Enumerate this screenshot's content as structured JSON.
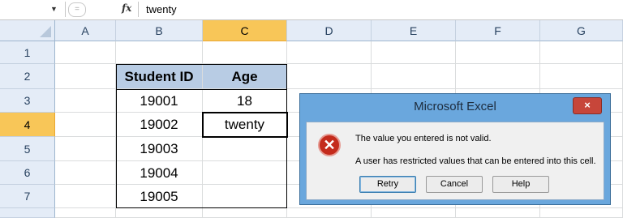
{
  "formula_bar": {
    "fx": "fx",
    "value": "twenty",
    "dd": "▼"
  },
  "columns": [
    "A",
    "B",
    "C",
    "D",
    "E",
    "F",
    "G"
  ],
  "rows": [
    "1",
    "2",
    "3",
    "4",
    "5",
    "6",
    "7"
  ],
  "table": {
    "headers": [
      "Student ID",
      "Age"
    ],
    "ids": [
      "19001",
      "19002",
      "19003",
      "19004",
      "19005"
    ],
    "ages": [
      "18",
      "twenty",
      "",
      "",
      ""
    ]
  },
  "dialog": {
    "title": "Microsoft Excel",
    "close": "×",
    "icon_glyph": "✕",
    "message1": "The value you entered is not valid.",
    "message2": "A user has restricted values that can be entered into this cell.",
    "buttons": {
      "retry": "Retry",
      "cancel": "Cancel",
      "help": "Help"
    }
  }
}
